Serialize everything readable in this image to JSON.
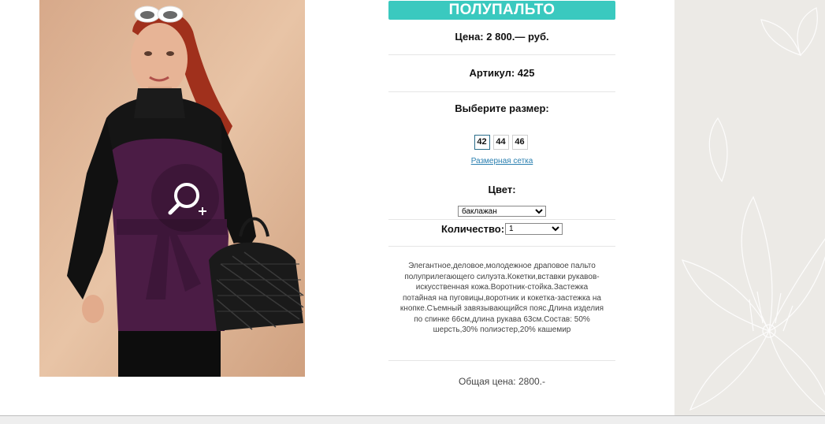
{
  "product": {
    "title": "ПОЛУПАЛЬТО",
    "price": "Цена: 2 800.— руб.",
    "article": "Артикул: 425",
    "size_label": "Выберите размер:",
    "sizes": [
      "42",
      "44",
      "46"
    ],
    "selected_size": "42",
    "size_chart_link": "Размерная сетка",
    "color_label": "Цвет:",
    "color_value": "баклажан",
    "quantity_label": "Количество:",
    "quantity_value": "1",
    "description": "Элегантное,деловое,молодежное драповое пальто полуприлегающего силуэта.Кокетки,вставки рукавов-искусственная кожа.Воротник-стойка.Застежка потайная на пуговицы,воротник и кокетка-застежка на кнопке.Съемный завязывающийся пояс.Длина изделия по спинке 66см,длина рукава 63см.Состав: 50% шерсть,30% полиэстер,20% кашемир",
    "total": "Общая цена: 2800.-"
  },
  "colors": {
    "title_bar": "#3ac9bf",
    "link": "#2a7fb0",
    "page_background": "#eceae6"
  },
  "icons": {
    "zoom": "zoom-in-icon"
  }
}
